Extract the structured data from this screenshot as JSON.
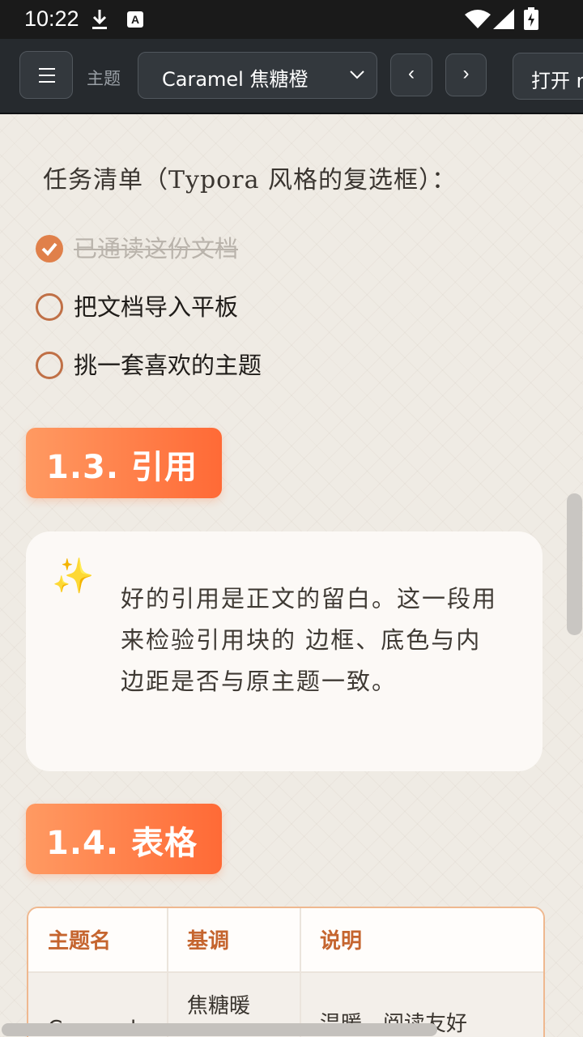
{
  "status_bar": {
    "time": "10:22",
    "icons": [
      "download-icon",
      "a-badge-icon",
      "wifi-icon",
      "signal-icon",
      "battery-charging-icon"
    ]
  },
  "toolbar": {
    "menu_icon": "hamburger-menu-icon",
    "theme_label": "主题",
    "theme_value": "Caramel 焦糖橙",
    "prev_label": "‹",
    "next_label": "›",
    "open_label": "打开 m"
  },
  "content": {
    "tasks_title": "任务清单（Typora 风格的复选框）：",
    "tasks": [
      {
        "label": "已通读这份文档",
        "checked": true
      },
      {
        "label": "把文档导入平板",
        "checked": false
      },
      {
        "label": "挑一套喜欢的主题",
        "checked": false
      }
    ],
    "section_quote_title": "1.3. 引用",
    "quote_icon": "sparkles-icon",
    "quote_text": "好的引用是正文的留白。这一段用来检验引用块的 边框、底色与内边距是否与原主题一致。",
    "section_table_title": "1.4. 表格",
    "table": {
      "headers": [
        "主题名",
        "基调",
        "说明"
      ],
      "rows": [
        [
          "Caramel",
          "焦糖暖",
          "温暖，阅读友好"
        ]
      ]
    }
  },
  "colors": {
    "accent": "#ff7a45",
    "checkbox": "#c07046",
    "table_header_text": "#c5652f"
  }
}
